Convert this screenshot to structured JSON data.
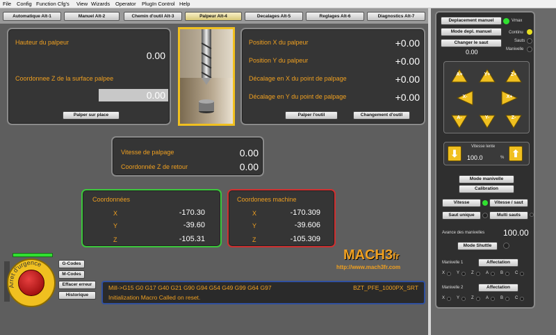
{
  "menu": [
    "File",
    "Config",
    "Function Cfg's",
    "View",
    "Wizards",
    "Operator",
    "PlugIn Control",
    "Help"
  ],
  "tabs": [
    "Automatique Alt-1",
    "Manuel Alt-2",
    "Chemin d'outil Alt-3",
    "Palpeur Alt-4",
    "Decalages Alt-5",
    "Reglages Alt-6",
    "Diagnostics Alt-7"
  ],
  "probe_height": {
    "label": "Hauteur du palpeur",
    "value": "0.00",
    "surface_label": "Coordonnee Z de la surface palpee",
    "surface_value": "0.00",
    "button": "Palper sur place"
  },
  "positions": {
    "rows": [
      {
        "label": "Position X du palpeur",
        "value": "+0.00"
      },
      {
        "label": "Position Y du palpeur",
        "value": "+0.00"
      },
      {
        "label": "Décalage en X du point de palpage",
        "value": "+0.00"
      },
      {
        "label": "Décalage en Y du point de palpage",
        "value": "+0.00"
      }
    ],
    "btn_probe": "Palper l'outil",
    "btn_change": "Changement d'outil"
  },
  "speed": {
    "label1": "Vitesse de palpage",
    "value1": "0.00",
    "label2": "Coordonnée Z de retour",
    "value2": "0.00"
  },
  "coords": {
    "title": "Coordonnées",
    "rows": [
      {
        "axis": "X",
        "value": "-170.30"
      },
      {
        "axis": "Y",
        "value": "-39.60"
      },
      {
        "axis": "Z",
        "value": "-105.31"
      }
    ]
  },
  "machine": {
    "title": "Coordonees machine",
    "rows": [
      {
        "axis": "X",
        "value": "-170.309"
      },
      {
        "axis": "Y",
        "value": "-39.606"
      },
      {
        "axis": "Z",
        "value": "-105.309"
      }
    ]
  },
  "logo": {
    "text": "MACH3",
    "suffix": "fr",
    "url": "http://www.mach3fr.com"
  },
  "estop": {
    "label": "Arret d'urgence"
  },
  "left_buttons": [
    "G-Codes",
    "M-Codes",
    "Effacer erreur",
    "Historique"
  ],
  "status": {
    "gcodes": "Mill->G15  G0 G17 G40 G21 G90 G94 G54 G49 G99 G64 G97",
    "profile": "BZT_PFE_1000PX_SRT",
    "message": "Initialization Macro Called on reset."
  },
  "jog": {
    "btn_deplacement": "Deplacement manuel",
    "btn_mode": "Mode depl. manuel",
    "btn_saut": "Changer le saut",
    "saut_value": "0.00",
    "leds": [
      "Vmax",
      "Continu",
      "Sauts",
      "Manivelle"
    ],
    "axes": [
      "A+",
      "Y+",
      "Z+",
      "X-",
      "X+",
      "A-",
      "Y-",
      "Z-"
    ],
    "slow_label": "Vitesse lente",
    "slow_value": "100.0",
    "slow_unit": "%",
    "btn_manivelle": "Mode manivelle",
    "btn_calibration": "Calibration",
    "btn_vitesse": "Vitesse",
    "btn_vitesse_saut": "Vitesse / saut",
    "btn_saut_unique": "Saut unique",
    "btn_multi": "Multi sauts",
    "advance_label": "Avance des manivelles",
    "advance_value": "100.00",
    "btn_shuttle": "Mode Shuttle",
    "man1": "Manivelle 1",
    "man2": "Manivelle 2",
    "btn_affectation": "Affectation",
    "axis_letters": [
      "X",
      "Y",
      "Z",
      "A",
      "B",
      "C"
    ]
  },
  "colors": {
    "label": "#f0a020",
    "green": "#3cc83c",
    "red": "#d03030",
    "led_green": "#30e030",
    "led_yellow": "#e8e020"
  }
}
